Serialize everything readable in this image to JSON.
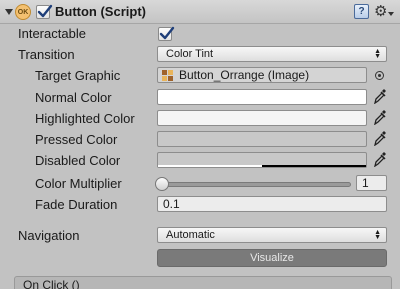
{
  "component": {
    "title": "Button (Script)",
    "enabled": true,
    "icon_name": "script-component-icon",
    "script_icon_text": "OK",
    "help_icon_text": "?"
  },
  "properties": {
    "interactable": {
      "label": "Interactable",
      "checked": true
    },
    "transition": {
      "label": "Transition",
      "value": "Color Tint"
    },
    "target_graphic": {
      "label": "Target Graphic",
      "value": "Button_Orrange (Image)"
    },
    "normal_color": {
      "label": "Normal Color",
      "color": "#ffffff"
    },
    "highlighted_color": {
      "label": "Highlighted Color",
      "color": "#f5f5f5"
    },
    "pressed_color": {
      "label": "Pressed Color",
      "color": "#c8c8c8"
    },
    "disabled_color": {
      "label": "Disabled Color",
      "color": "#c8c8c8",
      "alpha_bar": 0.5
    },
    "color_multiplier": {
      "label": "Color Multiplier",
      "value": "1",
      "slider_fraction": 0.0
    },
    "fade_duration": {
      "label": "Fade Duration",
      "value": "0.1"
    },
    "navigation": {
      "label": "Navigation",
      "value": "Automatic"
    },
    "visualize": {
      "label": "Visualize"
    }
  },
  "events": {
    "on_click_label": "On Click ()"
  },
  "colors": {
    "panel_bg": "#c2c2c2",
    "visualize_button_bg": "#7a7a7a",
    "icon_orange": "#f3c070",
    "obj_icon_brown": "#a0632a"
  }
}
